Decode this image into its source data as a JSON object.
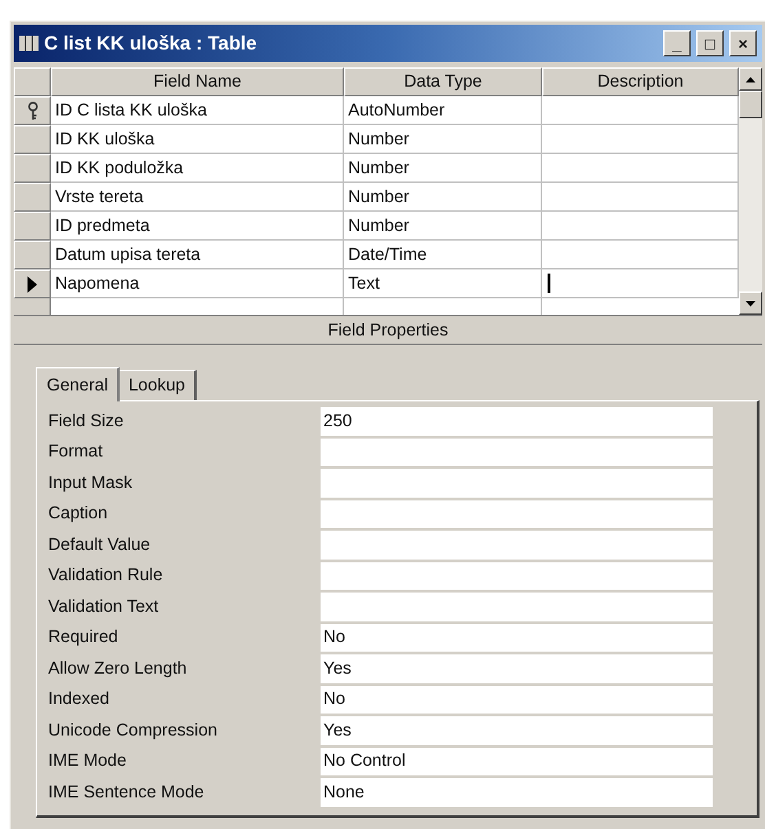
{
  "window": {
    "title": "C list KK uloška : Table",
    "controls": [
      "_",
      "□",
      "×"
    ]
  },
  "table": {
    "columns": [
      "Field Name",
      "Data Type",
      "Description"
    ],
    "rows": [
      {
        "field_name": "ID C lista KK uloška",
        "data_type": "AutoNumber",
        "primary_key": true,
        "selected": false
      },
      {
        "field_name": "ID KK uloška",
        "data_type": "Number",
        "primary_key": false,
        "selected": false
      },
      {
        "field_name": "ID KK poduložka",
        "data_type": "Number",
        "primary_key": false,
        "selected": false
      },
      {
        "field_name": "Vrste tereta",
        "data_type": "Number",
        "primary_key": false,
        "selected": false
      },
      {
        "field_name": "ID predmeta",
        "data_type": "Number",
        "primary_key": false,
        "selected": false
      },
      {
        "field_name": "Datum upisa tereta",
        "data_type": "Date/Time",
        "primary_key": false,
        "selected": false
      },
      {
        "field_name": "Napomena",
        "data_type": "Text",
        "primary_key": false,
        "selected": true
      }
    ]
  },
  "field_properties": {
    "title": "Field Properties",
    "tabs": [
      {
        "label": "General",
        "selected": true
      },
      {
        "label": "Lookup",
        "selected": false
      }
    ],
    "properties": [
      {
        "label": "Field Size",
        "value": "250"
      },
      {
        "label": "Format"
      },
      {
        "label": "Input Mask"
      },
      {
        "label": "Caption"
      },
      {
        "label": "Default Value"
      },
      {
        "label": "Validation Rule"
      },
      {
        "label": "Validation Text"
      },
      {
        "label": "Required",
        "value": "No"
      },
      {
        "label": "Allow Zero Length",
        "value": "Yes"
      },
      {
        "label": "Indexed",
        "value": "No"
      },
      {
        "label": "Unicode Compression",
        "value": "Yes"
      },
      {
        "label": "IME Mode",
        "value": "No Control"
      },
      {
        "label": "IME Sentence Mode",
        "value": "None"
      }
    ]
  }
}
